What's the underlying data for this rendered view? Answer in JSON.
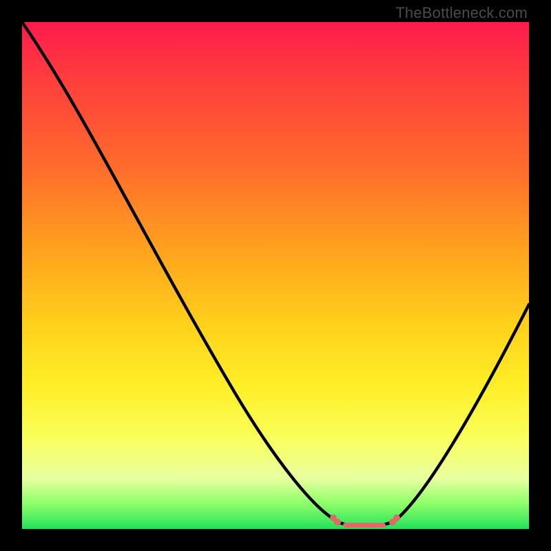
{
  "watermark": "TheBottleneck.com",
  "colors": {
    "background": "#000000",
    "gradient_top": "#ff1a4d",
    "gradient_mid1": "#ff6a2c",
    "gradient_mid2": "#ffd21a",
    "gradient_mid3": "#faff5a",
    "gradient_bottom": "#22e25a",
    "curve": "#000000",
    "marker": "#e06a6a"
  },
  "chart_data": {
    "type": "line",
    "title": "",
    "xlabel": "",
    "ylabel": "",
    "ylim": [
      0,
      100
    ],
    "x": [
      0,
      5,
      10,
      15,
      20,
      25,
      30,
      35,
      40,
      45,
      50,
      55,
      60,
      62,
      64,
      66,
      68,
      70,
      72,
      75,
      80,
      85,
      90,
      95,
      100
    ],
    "values": [
      100,
      93,
      85,
      78,
      70,
      63,
      55,
      47,
      40,
      32,
      24,
      16,
      7,
      4,
      2,
      1,
      1,
      2,
      4,
      8,
      15,
      23,
      32,
      41,
      50
    ],
    "marker_flat_region": {
      "x_start": 60,
      "x_end": 72,
      "y": 2,
      "dot_x_positions": [
        60,
        62,
        64,
        66,
        68,
        70,
        72
      ]
    }
  }
}
